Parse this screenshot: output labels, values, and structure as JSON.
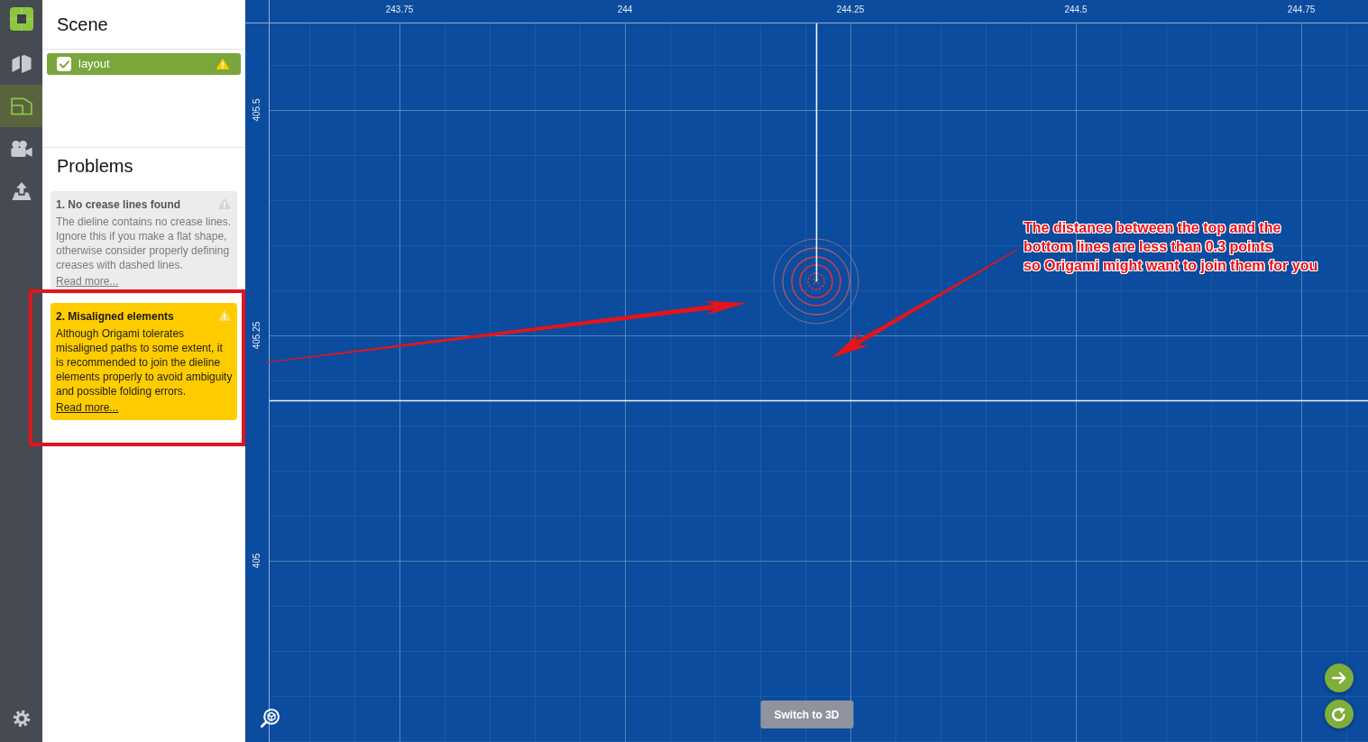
{
  "sidebar": {
    "nav_items": [
      {
        "selected": false
      },
      {
        "selected": true
      },
      {
        "selected": false
      },
      {
        "selected": false
      }
    ]
  },
  "scene_panel": {
    "title": "Scene",
    "items": [
      {
        "label": "layout",
        "checked": true,
        "selected": true,
        "warning": true
      }
    ]
  },
  "problems_panel": {
    "title": "Problems",
    "problems": [
      {
        "title": "1. No crease lines found",
        "text": "The dieline contains no crease lines. Ignore this if you make a flat shape, otherwise consider properly defining creases with dashed lines.",
        "link": "Read more...",
        "selected": false
      },
      {
        "title": "2. Misaligned elements",
        "text": "Although Origami tolerates misaligned paths to some extent, it is recommended to join the dieline elements properly to avoid ambiguity and possible folding errors.",
        "link": "Read more...",
        "selected": true
      }
    ]
  },
  "canvas": {
    "x_ruler": [
      "243.75",
      "244",
      "244.25",
      "244.5",
      "244.75"
    ],
    "y_ruler": [
      "405.5",
      "405.25",
      "405"
    ],
    "annotation": {
      "lines": [
        "The distance between the top and the",
        "bottom lines are less than 0.3 points",
        "so Origami might want to join them for you"
      ]
    },
    "switch_button": "Switch to 3D"
  }
}
